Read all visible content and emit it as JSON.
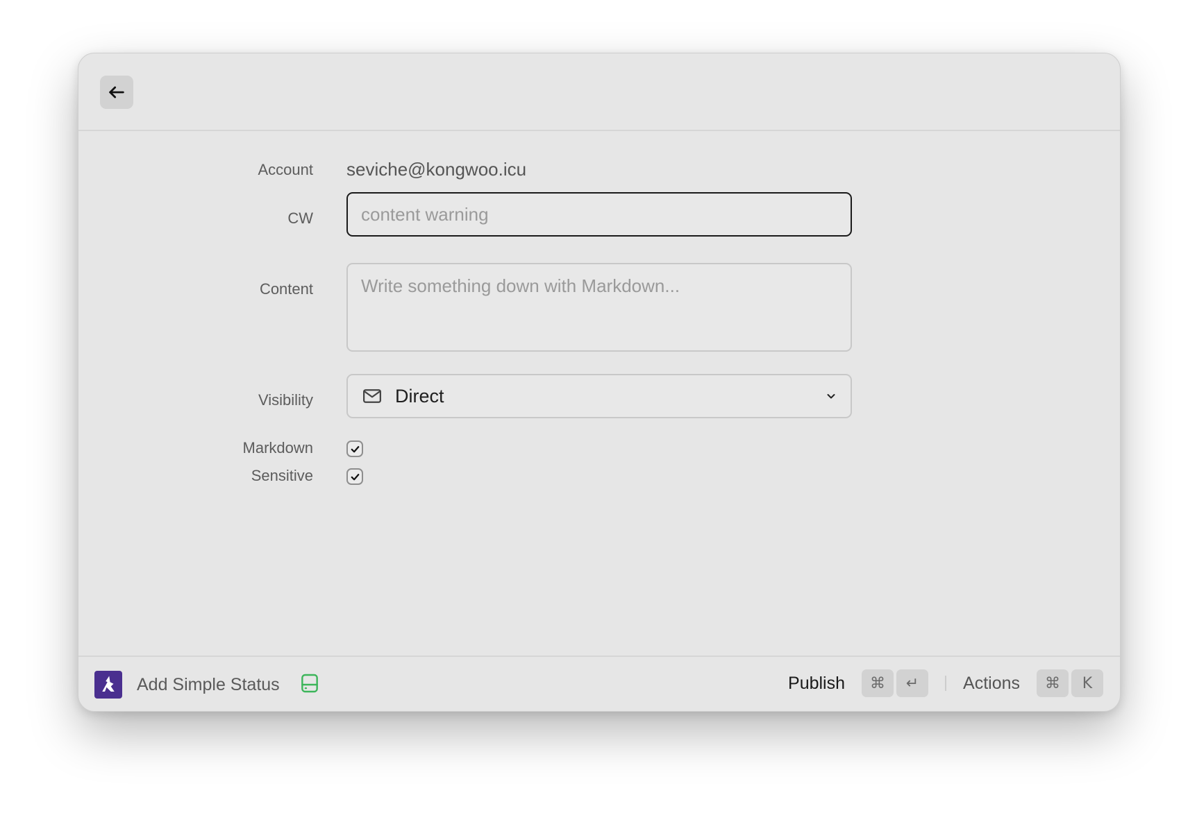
{
  "header": {
    "back_icon": "arrow-left-icon"
  },
  "form": {
    "account": {
      "label": "Account",
      "value": "seviche@kongwoo.icu"
    },
    "cw": {
      "label": "CW",
      "value": "",
      "placeholder": "content warning"
    },
    "content": {
      "label": "Content",
      "value": "",
      "placeholder": "Write something down with Markdown..."
    },
    "visibility": {
      "label": "Visibility",
      "selected": "Direct",
      "icon": "mail-icon"
    },
    "markdown": {
      "label": "Markdown",
      "checked": true
    },
    "sensitive": {
      "label": "Sensitive",
      "checked": true
    }
  },
  "footer": {
    "title": "Add Simple Status",
    "logo_icon": "app-logo-icon",
    "status_icon": "drive-icon",
    "status_icon_color": "#3cb55a",
    "primary_action": {
      "label": "Publish",
      "keys": [
        "⌘",
        "↵"
      ]
    },
    "secondary_action": {
      "label": "Actions",
      "keys": [
        "⌘",
        "K"
      ]
    }
  },
  "colors": {
    "window_bg": "#e6e6e6",
    "logo_bg": "#4a2f8f"
  }
}
